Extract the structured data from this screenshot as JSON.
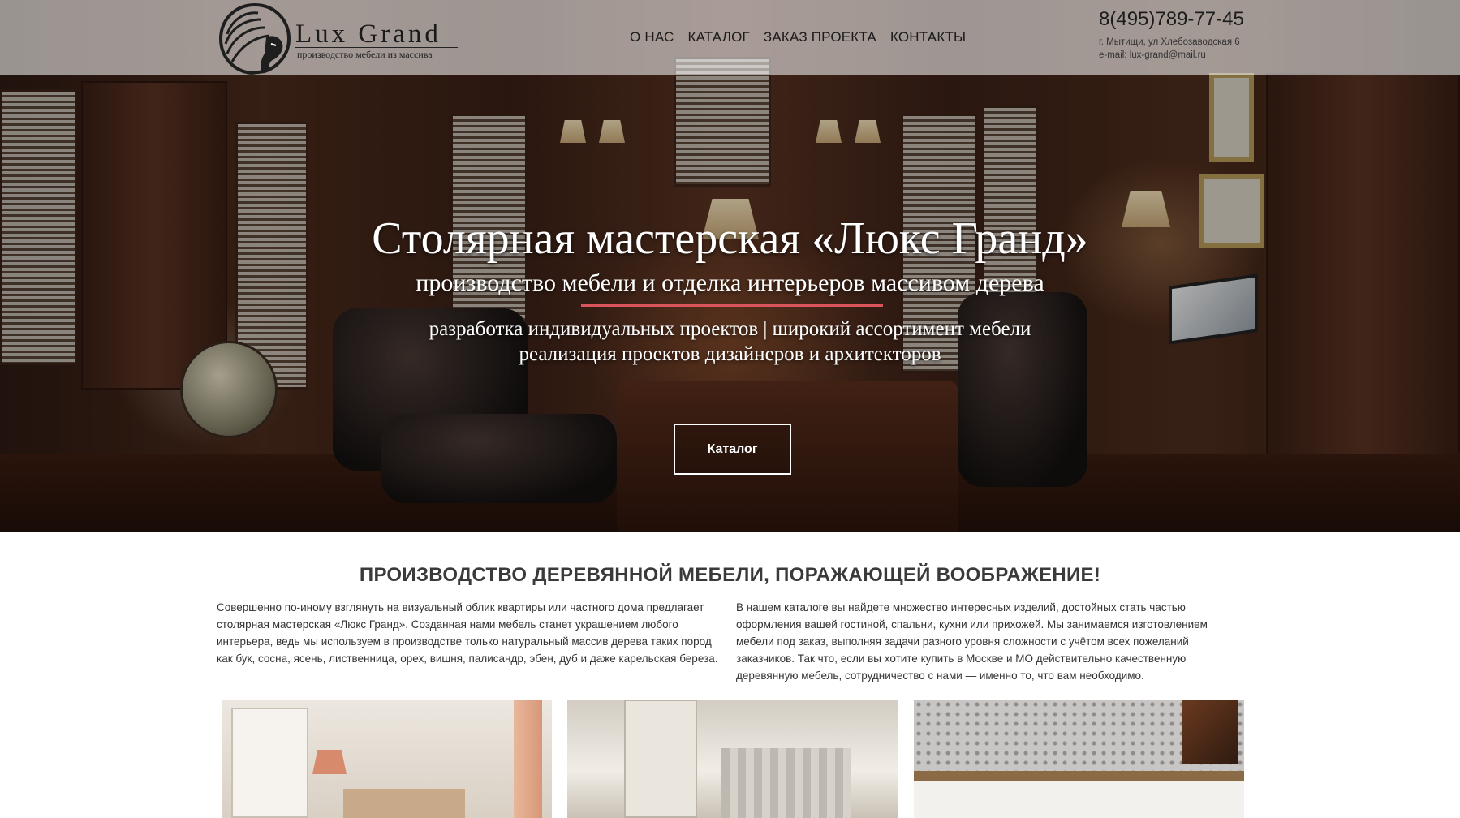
{
  "header": {
    "logo": {
      "brand": "Lux Grand",
      "tagline": "производство мебели из массива"
    },
    "nav": [
      {
        "label": "О НАС"
      },
      {
        "label": "КАТАЛОГ"
      },
      {
        "label": "ЗАКАЗ ПРОЕКТА"
      },
      {
        "label": "КОНТАКТЫ"
      }
    ],
    "contact": {
      "phone": "8(495)789-77-45",
      "address": "г. Мытищи, ул Хлебозаводская 6",
      "email": "e-mail: lux-grand@mail.ru"
    }
  },
  "hero": {
    "title": "Столярная мастерская «Люкс Гранд»",
    "subtitle": "производство мебели и отделка интерьеров массивом дерева",
    "line1": "разработка индивидуальных проектов | широкий ассортимент мебели",
    "line2": "реализация проектов дизайнеров и архитекторов",
    "button": "Каталог"
  },
  "content": {
    "title": "ПРОИЗВОДСТВО ДЕРЕВЯННОЙ МЕБЕЛИ, ПОРАЖАЮЩЕЙ ВООБРАЖЕНИЕ!",
    "left": "Совершенно по-иному взглянуть на визуальный облик квартиры или частного дома предлагает столярная мастерская «Люкс Гранд». Созданная нами мебель станет украшением любого интерьера, ведь мы используем в производстве только натуральный массив дерева таких пород как бук, сосна, ясень, лиственница, орех, вишня, палисандр, эбен, дуб и даже карельская береза.",
    "right": "В нашем каталоге вы найдете множество интересных изделий, достойных стать частью оформления вашей гостиной, спальни, кухни или прихожей. Мы занимаемся изготовлением мебели под заказ, выполняя задачи разного уровня сложности с учётом всех пожеланий заказчиков. Так что, если вы хотите купить в Москве и МО действительно качественную деревянную мебель, сотрудничество с нами — именно то, что вам необходимо."
  },
  "colors": {
    "accent_line": "#d9545b",
    "header_bg": "rgba(255,255,255,0.55)",
    "text": "#333333"
  }
}
